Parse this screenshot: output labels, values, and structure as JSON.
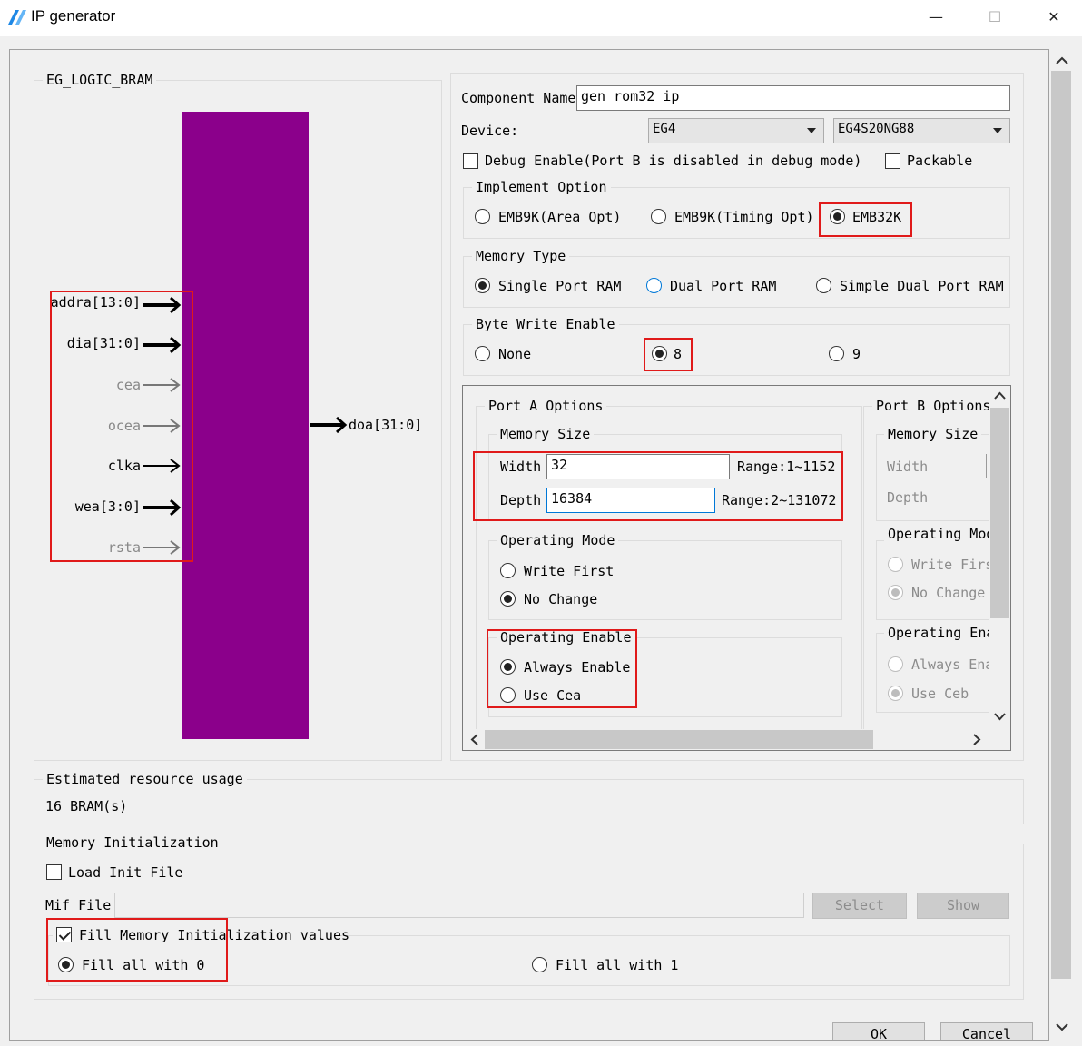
{
  "window": {
    "title": "IP generator",
    "min": "—",
    "max": "☐",
    "close": "✕"
  },
  "preview": {
    "title": "EG_LOGIC_BRAM",
    "block_color": "#8b008b",
    "inputs": [
      {
        "label": "addra[13:0]",
        "bold": true
      },
      {
        "label": "dia[31:0]",
        "bold": true
      },
      {
        "label": "cea",
        "bold": false
      },
      {
        "label": "ocea",
        "bold": false
      },
      {
        "label": "clka",
        "bold": false,
        "dark": true
      },
      {
        "label": "wea[3:0]",
        "bold": true
      },
      {
        "label": "rsta",
        "bold": false
      }
    ],
    "output": "doa[31:0]"
  },
  "component": {
    "name_label": "Component Name",
    "name_value": "gen_rom32_ip"
  },
  "device": {
    "label": "Device:",
    "family": "EG4",
    "part": "EG4S20NG88"
  },
  "debug": {
    "label": "Debug Enable(Port B is disabled in debug mode)",
    "checked": false
  },
  "packable": {
    "label": "Packable",
    "checked": false
  },
  "implement": {
    "title": "Implement Option",
    "options": [
      "EMB9K(Area Opt)",
      "EMB9K(Timing Opt)",
      "EMB32K"
    ],
    "selected": 2
  },
  "memory_type": {
    "title": "Memory Type",
    "options": [
      "Single Port RAM",
      "Dual Port RAM",
      "Simple Dual Port RAM"
    ],
    "selected": 0
  },
  "byte_write": {
    "title": "Byte Write Enable",
    "options": [
      "None",
      "8",
      "9"
    ],
    "selected": 1
  },
  "port_a": {
    "title": "Port A Options",
    "mem_size_title": "Memory Size",
    "width_label": "Width",
    "width_value": "32",
    "width_range": "Range:1~1152",
    "depth_label": "Depth",
    "depth_value": "16384",
    "depth_range": "Range:2~131072",
    "op_mode_title": "Operating Mode",
    "op_mode_options": [
      "Write First",
      "No Change"
    ],
    "op_mode_selected": 1,
    "op_enable_title": "Operating Enable",
    "op_enable_options": [
      "Always Enable",
      "Use Cea"
    ],
    "op_enable_selected": 0
  },
  "port_b": {
    "title": "Port B Options",
    "mem_size_title": "Memory Size",
    "width_label": "Width",
    "depth_label": "Depth",
    "op_mode_title": "Operating Mod",
    "op_mode_options": [
      "Write Firs",
      "No Change"
    ],
    "op_enable_title": "Operating Ena",
    "op_enable_options": [
      "Always Ena",
      "Use Ceb"
    ]
  },
  "resource": {
    "title": "Estimated resource usage",
    "value": "16 BRAM(s)"
  },
  "mem_init": {
    "title": "Memory Initialization",
    "load_label": "Load Init File",
    "load_checked": false,
    "mif_label": "Mif File",
    "mif_value": "",
    "select_btn": "Select",
    "show_btn": "Show",
    "fill_label": "Fill Memory Initialization values",
    "fill_checked": true,
    "fill_options": [
      "Fill all with 0",
      "Fill all with 1"
    ],
    "fill_selected": 0
  },
  "footer": {
    "ok": "OK",
    "cancel": "Cancel"
  },
  "colors": {
    "highlight": "#e01a1a",
    "accent": "#0078d7"
  },
  "icons": {
    "app": "lightning-logo-icon",
    "scroll_up": "chevron-up-icon",
    "scroll_down": "chevron-down-icon"
  }
}
